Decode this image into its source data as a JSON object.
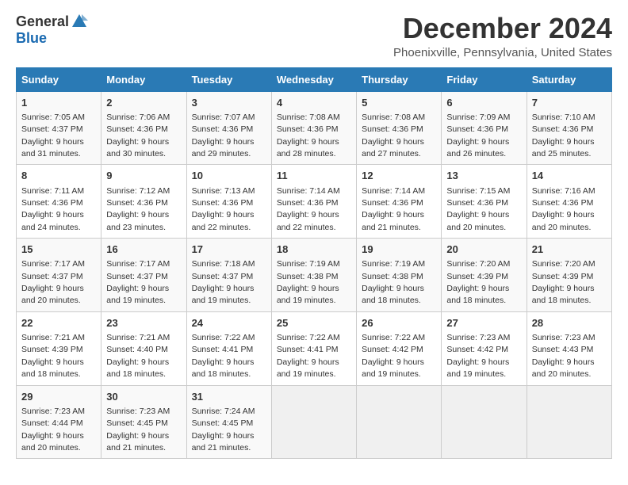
{
  "logo": {
    "general": "General",
    "blue": "Blue"
  },
  "title": "December 2024",
  "subtitle": "Phoenixville, Pennsylvania, United States",
  "days_of_week": [
    "Sunday",
    "Monday",
    "Tuesday",
    "Wednesday",
    "Thursday",
    "Friday",
    "Saturday"
  ],
  "weeks": [
    [
      {
        "day": "1",
        "sunrise": "7:05 AM",
        "sunset": "4:37 PM",
        "daylight": "9 hours and 31 minutes."
      },
      {
        "day": "2",
        "sunrise": "7:06 AM",
        "sunset": "4:36 PM",
        "daylight": "9 hours and 30 minutes."
      },
      {
        "day": "3",
        "sunrise": "7:07 AM",
        "sunset": "4:36 PM",
        "daylight": "9 hours and 29 minutes."
      },
      {
        "day": "4",
        "sunrise": "7:08 AM",
        "sunset": "4:36 PM",
        "daylight": "9 hours and 28 minutes."
      },
      {
        "day": "5",
        "sunrise": "7:08 AM",
        "sunset": "4:36 PM",
        "daylight": "9 hours and 27 minutes."
      },
      {
        "day": "6",
        "sunrise": "7:09 AM",
        "sunset": "4:36 PM",
        "daylight": "9 hours and 26 minutes."
      },
      {
        "day": "7",
        "sunrise": "7:10 AM",
        "sunset": "4:36 PM",
        "daylight": "9 hours and 25 minutes."
      }
    ],
    [
      {
        "day": "8",
        "sunrise": "7:11 AM",
        "sunset": "4:36 PM",
        "daylight": "9 hours and 24 minutes."
      },
      {
        "day": "9",
        "sunrise": "7:12 AM",
        "sunset": "4:36 PM",
        "daylight": "9 hours and 23 minutes."
      },
      {
        "day": "10",
        "sunrise": "7:13 AM",
        "sunset": "4:36 PM",
        "daylight": "9 hours and 22 minutes."
      },
      {
        "day": "11",
        "sunrise": "7:14 AM",
        "sunset": "4:36 PM",
        "daylight": "9 hours and 22 minutes."
      },
      {
        "day": "12",
        "sunrise": "7:14 AM",
        "sunset": "4:36 PM",
        "daylight": "9 hours and 21 minutes."
      },
      {
        "day": "13",
        "sunrise": "7:15 AM",
        "sunset": "4:36 PM",
        "daylight": "9 hours and 20 minutes."
      },
      {
        "day": "14",
        "sunrise": "7:16 AM",
        "sunset": "4:36 PM",
        "daylight": "9 hours and 20 minutes."
      }
    ],
    [
      {
        "day": "15",
        "sunrise": "7:17 AM",
        "sunset": "4:37 PM",
        "daylight": "9 hours and 20 minutes."
      },
      {
        "day": "16",
        "sunrise": "7:17 AM",
        "sunset": "4:37 PM",
        "daylight": "9 hours and 19 minutes."
      },
      {
        "day": "17",
        "sunrise": "7:18 AM",
        "sunset": "4:37 PM",
        "daylight": "9 hours and 19 minutes."
      },
      {
        "day": "18",
        "sunrise": "7:19 AM",
        "sunset": "4:38 PM",
        "daylight": "9 hours and 19 minutes."
      },
      {
        "day": "19",
        "sunrise": "7:19 AM",
        "sunset": "4:38 PM",
        "daylight": "9 hours and 18 minutes."
      },
      {
        "day": "20",
        "sunrise": "7:20 AM",
        "sunset": "4:39 PM",
        "daylight": "9 hours and 18 minutes."
      },
      {
        "day": "21",
        "sunrise": "7:20 AM",
        "sunset": "4:39 PM",
        "daylight": "9 hours and 18 minutes."
      }
    ],
    [
      {
        "day": "22",
        "sunrise": "7:21 AM",
        "sunset": "4:39 PM",
        "daylight": "9 hours and 18 minutes."
      },
      {
        "day": "23",
        "sunrise": "7:21 AM",
        "sunset": "4:40 PM",
        "daylight": "9 hours and 18 minutes."
      },
      {
        "day": "24",
        "sunrise": "7:22 AM",
        "sunset": "4:41 PM",
        "daylight": "9 hours and 18 minutes."
      },
      {
        "day": "25",
        "sunrise": "7:22 AM",
        "sunset": "4:41 PM",
        "daylight": "9 hours and 19 minutes."
      },
      {
        "day": "26",
        "sunrise": "7:22 AM",
        "sunset": "4:42 PM",
        "daylight": "9 hours and 19 minutes."
      },
      {
        "day": "27",
        "sunrise": "7:23 AM",
        "sunset": "4:42 PM",
        "daylight": "9 hours and 19 minutes."
      },
      {
        "day": "28",
        "sunrise": "7:23 AM",
        "sunset": "4:43 PM",
        "daylight": "9 hours and 20 minutes."
      }
    ],
    [
      {
        "day": "29",
        "sunrise": "7:23 AM",
        "sunset": "4:44 PM",
        "daylight": "9 hours and 20 minutes."
      },
      {
        "day": "30",
        "sunrise": "7:23 AM",
        "sunset": "4:45 PM",
        "daylight": "9 hours and 21 minutes."
      },
      {
        "day": "31",
        "sunrise": "7:24 AM",
        "sunset": "4:45 PM",
        "daylight": "9 hours and 21 minutes."
      },
      null,
      null,
      null,
      null
    ]
  ],
  "labels": {
    "sunrise": "Sunrise:",
    "sunset": "Sunset:",
    "daylight": "Daylight:"
  }
}
